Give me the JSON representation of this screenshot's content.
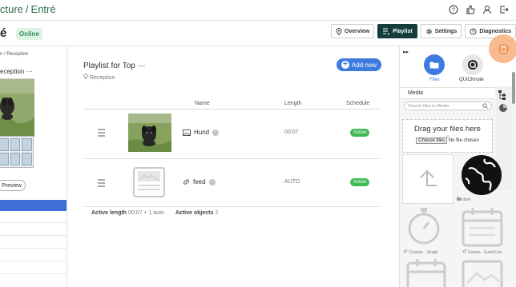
{
  "breadcrumb": {
    "parent": "cture",
    "separator": "/",
    "current": "Entré"
  },
  "top_icons": [
    "help-icon",
    "thumbs-up-icon",
    "user-icon",
    "logout-icon"
  ],
  "player": {
    "name": "é",
    "status": "Online"
  },
  "nav_tabs": [
    {
      "label": "Overview",
      "icon": "location-pin-icon",
      "active": false
    },
    {
      "label": "Playlist",
      "icon": "playlist-icon",
      "active": true
    },
    {
      "label": "Settings",
      "icon": "gear-icon",
      "active": false
    },
    {
      "label": "Diagnostics",
      "icon": "help-circle-icon",
      "active": false
    }
  ],
  "left_panel": {
    "crumb": "n / Reception",
    "title": "eception",
    "title_menu": "···",
    "preview_label": "Preview"
  },
  "playlist": {
    "title": "Playlist for Top",
    "title_menu": "···",
    "location": "Reception",
    "add_new": "Add new",
    "columns": {
      "name": "Name",
      "length": "Length",
      "schedule": "Schedule"
    },
    "items": [
      {
        "name": "Hund",
        "type_icon": "image-icon",
        "length": "00:07",
        "status": "Active"
      },
      {
        "name": "feed",
        "type_icon": "link-icon",
        "length": "AUTO",
        "status": "Active"
      }
    ],
    "footer": {
      "active_length_label": "Active length",
      "active_length_value": "00:07 + 1 auto",
      "active_objects_label": "Active objects",
      "active_objects_value": "2"
    }
  },
  "right_panel": {
    "expand": "▸▸",
    "tools": [
      {
        "label": "Files",
        "icon": "folder-icon",
        "active": true
      },
      {
        "label": "QUICKnote",
        "icon": "quicknote-icon",
        "active": false
      }
    ],
    "media_label": "Media",
    "search_placeholder": "Search files in Media",
    "dropzone_title": "Drag your files here",
    "dropzone_or": "or",
    "choose_files": "Choose files",
    "no_file": "No file chosen",
    "tiles": [
      {
        "label": "",
        "icon": "upload-arrow-icon"
      },
      {
        "label": "dark",
        "icon": "globe-icon"
      },
      {
        "label": "Counter - Single",
        "icon": "stopwatch-icon"
      },
      {
        "label": "Events - Event List",
        "icon": "calendar-icon"
      }
    ]
  },
  "colors": {
    "brand_green": "#2e6b4b",
    "accent_blue": "#3e7be0",
    "active_green": "#3fb954",
    "active_tab": "#153d3a",
    "highlight": "#f0904f"
  }
}
